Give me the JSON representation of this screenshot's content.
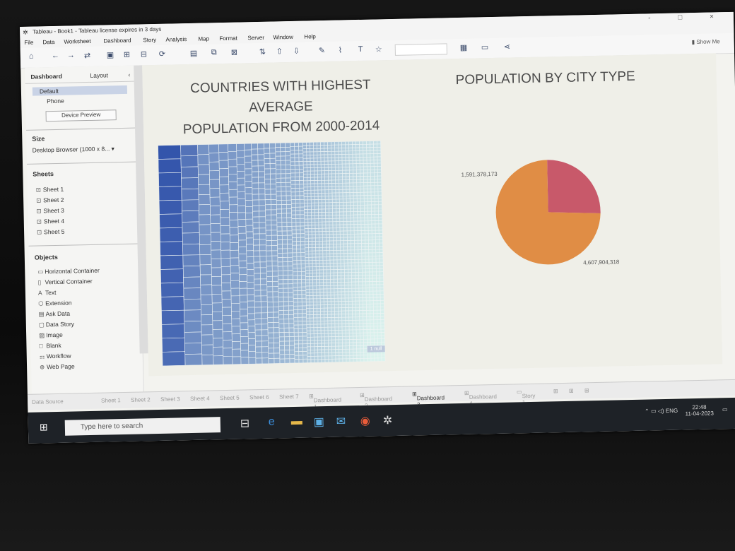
{
  "window": {
    "title": "Tableau - Book1 - Tableau license expires in 3 days",
    "controls": "- □ ×"
  },
  "menu": [
    "File",
    "Data",
    "Worksheet",
    "Dashboard",
    "Story",
    "Analysis",
    "Map",
    "Format",
    "Server",
    "Window",
    "Help"
  ],
  "toolbar": {
    "show_me": "Show Me"
  },
  "sidebar": {
    "tabs": [
      "Dashboard",
      "Layout"
    ],
    "device_options": [
      "Default",
      "Phone"
    ],
    "device_preview": "Device Preview",
    "size_header": "Size",
    "size_value": "Desktop Browser (1000 x 8...",
    "sheets_header": "Sheets",
    "sheets": [
      "Sheet 1",
      "Sheet 2",
      "Sheet 3",
      "Sheet 4",
      "Sheet 5"
    ],
    "objects_header": "Objects",
    "objects": [
      "Horizontal Container",
      "Vertical Container",
      "Text",
      "Extension",
      "Ask Data",
      "Data Story",
      "Image",
      "Blank",
      "Workflow",
      "Web Page"
    ]
  },
  "dashboard": {
    "treemap_title": [
      "COUNTRIES WITH HIGHEST",
      "AVERAGE",
      "POPULATION FROM 2000-2014"
    ],
    "pie_title": "POPULATION BY CITY TYPE",
    "mark_badge": "1 null"
  },
  "chart_data": {
    "type": "pie",
    "title": "POPULATION BY CITY TYPE",
    "series": [
      {
        "label": "1,591,378,173",
        "value": 1591378173,
        "color": "#c8596a"
      },
      {
        "label": "4,607,904,318",
        "value": 4607904318,
        "color": "#e08d45"
      }
    ]
  },
  "tabs": [
    "Data Source",
    "Sheet 1",
    "Sheet 2",
    "Sheet 3",
    "Sheet 4",
    "Sheet 5",
    "Sheet 6",
    "Sheet 7",
    "Dashboard 1",
    "Dashboard 2",
    "Dashboard 3",
    "Dashboard 4",
    "Story 1"
  ],
  "taskbar": {
    "search_placeholder": "Type here to search",
    "lang": "ENG",
    "time": "22:48",
    "date": "11-04-2023"
  }
}
